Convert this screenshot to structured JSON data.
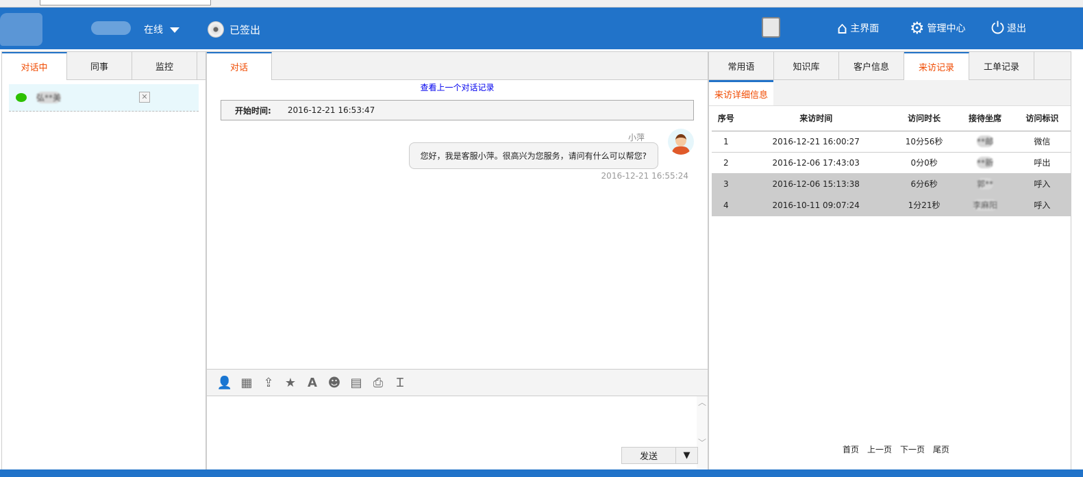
{
  "header": {
    "status": "在线",
    "signout": "已签出",
    "home": "主界面",
    "admin": "管理中心",
    "logout": "退出"
  },
  "left": {
    "tabs": [
      "对话中",
      "同事",
      "监控"
    ],
    "conversations": [
      {
        "name": "弘**美",
        "channel": "wechat"
      }
    ]
  },
  "chat": {
    "tab": "对话",
    "prev_link": "查看上一个对话记录",
    "start_label": "开始时间:",
    "start_time": "2016-12-21 16:53:47",
    "message": {
      "sender": "小萍",
      "text": "您好，我是客服小萍。很高兴为您服务，请问有什么可以帮您?",
      "time": "2016-12-21 16:55:24"
    },
    "tools": [
      "transfer-icon",
      "whiteboard-icon",
      "upload-icon",
      "favorite-icon",
      "font-icon",
      "emoji-icon",
      "quick-reply-icon",
      "print-icon",
      "text-cursor-icon"
    ],
    "send": "发送"
  },
  "right": {
    "tabs": [
      "常用语",
      "知识库",
      "客户信息",
      "来访记录",
      "工单记录"
    ],
    "subtab": "来访详细信息",
    "columns": [
      "序号",
      "来访时间",
      "访问时长",
      "接待坐席",
      "访问标识"
    ],
    "rows": [
      [
        "1",
        "2016-12-21 16:00:27",
        "10分56秒",
        "**邮",
        "微信"
      ],
      [
        "2",
        "2016-12-06 17:43:03",
        "0分0秒",
        "**新",
        "呼出"
      ],
      [
        "3",
        "2016-12-06 15:13:38",
        "6分6秒",
        "郭**",
        "呼入"
      ],
      [
        "4",
        "2016-10-11 09:07:24",
        "1分21秒",
        "李麻阳",
        "呼入"
      ]
    ],
    "pager": [
      "首页",
      "上一页",
      "下一页",
      "尾页"
    ]
  },
  "colors": {
    "brand": "#2173c9",
    "accent": "#f04a00"
  }
}
